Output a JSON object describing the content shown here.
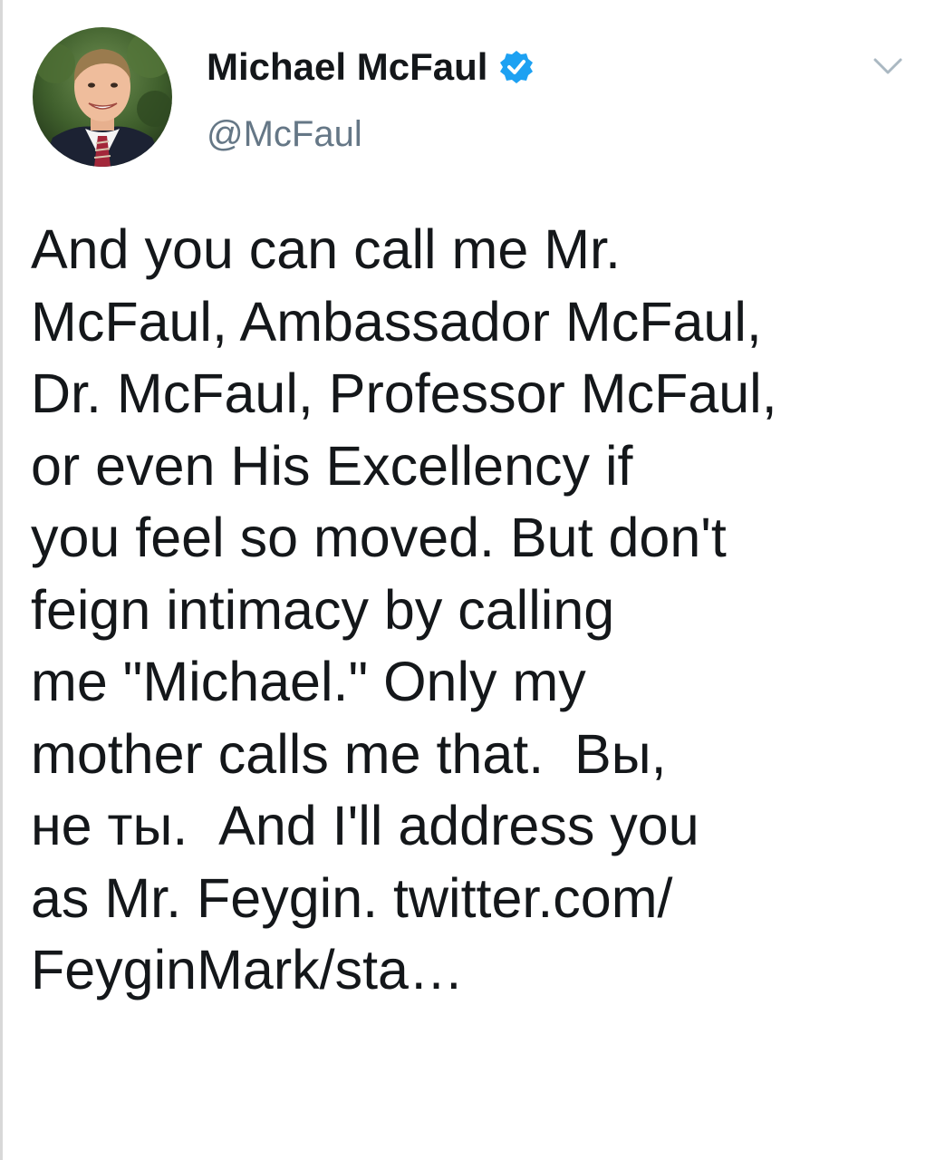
{
  "user": {
    "display_name": "Michael McFaul",
    "handle": "@McFaul",
    "verified": true,
    "avatar_icon": "profile-photo"
  },
  "tweet": {
    "lines": [
      "And you can call me Mr.",
      "McFaul, Ambassador McFaul,",
      "Dr. McFaul, Professor McFaul,",
      "or even His Excellency if",
      "you feel so moved. But don't",
      "feign intimacy by calling",
      "me \"Michael.\" Only my",
      "mother calls me that.  Вы,",
      "не ты.  And I'll address you",
      "as Mr. Feygin. twitter.com/",
      "FeyginMark/sta…"
    ]
  },
  "icons": {
    "verified": "verified-badge-icon",
    "menu": "chevron-down-icon"
  },
  "colors": {
    "verified_blue": "#1da1f2",
    "handle_gray": "#657786",
    "text": "#14171a",
    "chevron": "#aab8c2"
  }
}
